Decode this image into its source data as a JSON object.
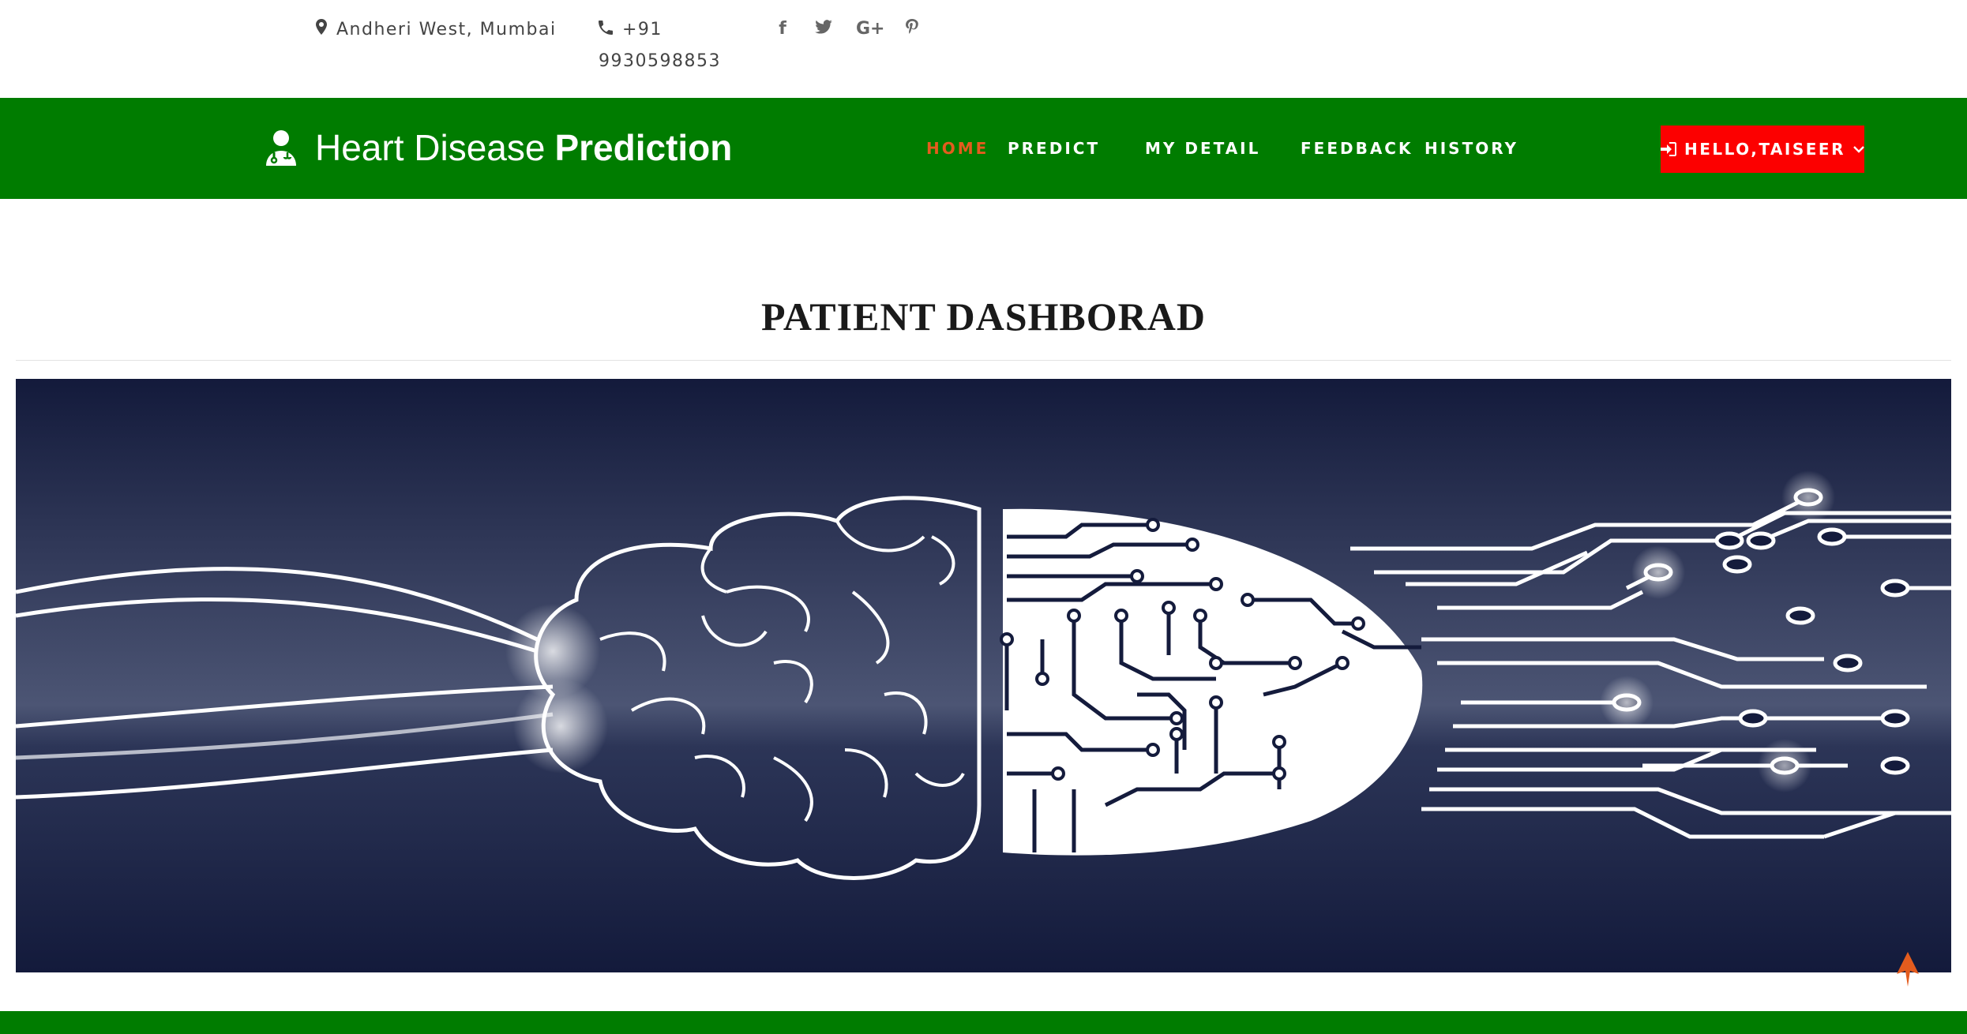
{
  "topbar": {
    "location": "Andheri West, Mumbai",
    "location_icon": "map-marker-icon",
    "phone_line1": "+91",
    "phone_line2": "9930598853",
    "phone_icon": "phone-icon",
    "social": [
      "facebook-icon",
      "twitter-icon",
      "google-plus-icon",
      "pinterest-icon"
    ]
  },
  "nav": {
    "brand_light": "Heart Disease",
    "brand_bold": "Prediction",
    "brand_icon": "doctor-icon",
    "links": [
      "HOME",
      "PREDICT",
      "MY DETAIL",
      "FEEDBACK",
      "HISTORY"
    ],
    "active": "HOME",
    "user_button": "HELLO,TAISEER",
    "user_icon": "sign-in-icon",
    "active_color": "#e45c1e",
    "nav_color": "#007c00",
    "user_button_color": "#fc0000"
  },
  "page": {
    "title": "PATIENT DASHBORAD"
  },
  "hero": {
    "image": "brain-circuit-illustration",
    "background_color": "#141b3c"
  },
  "scroll_top_icon": "arrow-up-icon"
}
